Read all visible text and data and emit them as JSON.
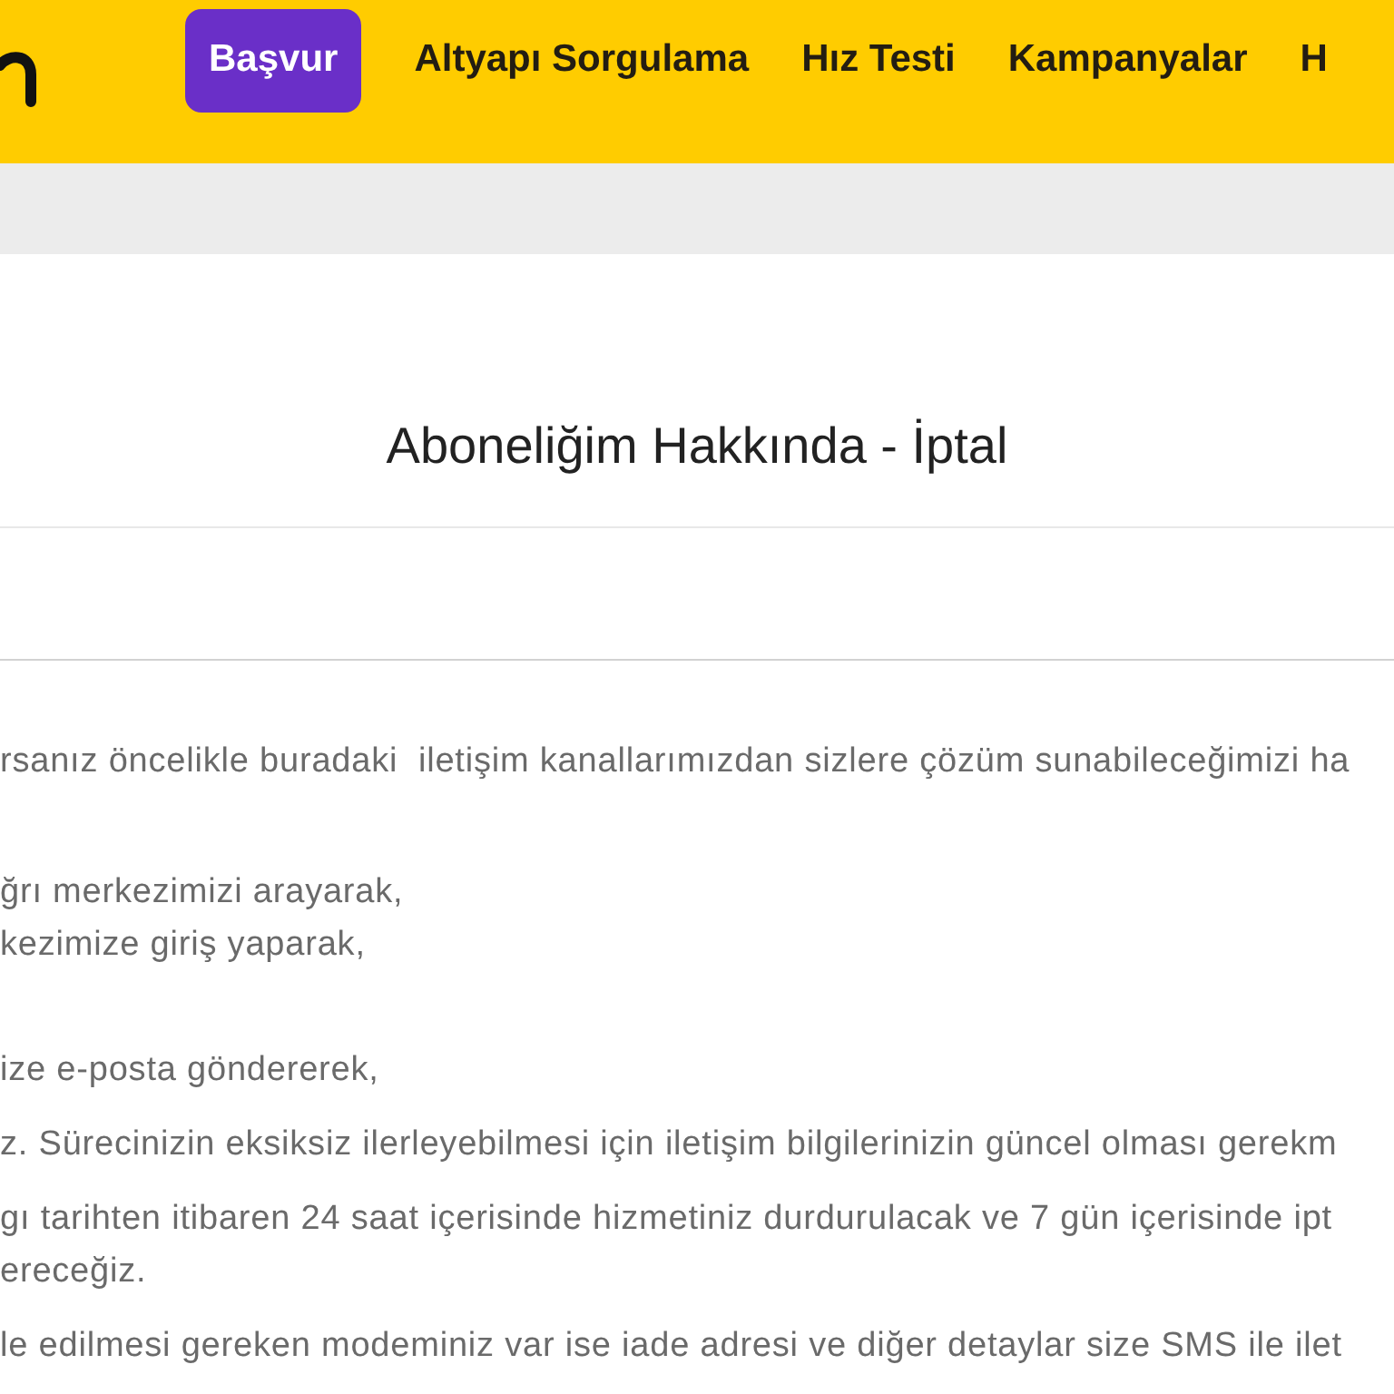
{
  "nav": [
    {
      "label": "Başvur",
      "kind": "cta"
    },
    {
      "label": "Altyapı Sorgulama",
      "kind": "link"
    },
    {
      "label": "Hız Testi",
      "kind": "link"
    },
    {
      "label": "Kampanyalar",
      "kind": "link"
    },
    {
      "label": "H",
      "kind": "link"
    }
  ],
  "page": {
    "title": "Aboneliğim Hakkında - İptal"
  },
  "content": {
    "blocks": [
      {
        "kind": "paragraph",
        "lines": [
          "rsanız öncelikle buradaki  iletişim kanallarımızdan sizlere çözüm sunabileceğimizi ha"
        ]
      },
      {
        "kind": "list",
        "lines": [
          "ğrı merkezimizi arayarak,",
          "kezimize giriş yaparak,"
        ]
      },
      {
        "kind": "paragraph",
        "lines": [
          "ize e-posta göndererek,"
        ]
      },
      {
        "kind": "paragraph",
        "lines": [
          "z. Sürecinizin eksiksiz ilerleyebilmesi için iletişim bilgilerinizin güncel olması gerekm"
        ]
      },
      {
        "kind": "paragraph",
        "lines": [
          "gı tarihten itibaren 24 saat içerisinde hizmetiniz durdurulacak ve 7 gün içerisinde ipt",
          "ereceğiz."
        ]
      },
      {
        "kind": "paragraph",
        "lines": [
          "le edilmesi gereken modeminiz var ise iade adresi ve diğer detaylar size SMS ile ilet"
        ]
      }
    ]
  }
}
